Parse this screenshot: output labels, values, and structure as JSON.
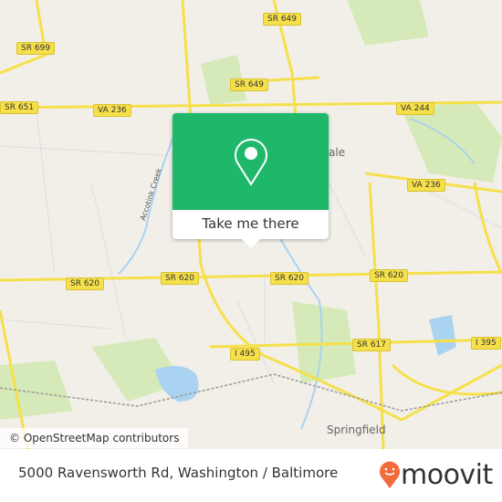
{
  "map": {
    "shields": [
      {
        "id": "sr699",
        "label": "SR 699"
      },
      {
        "id": "sr651",
        "label": "SR 651"
      },
      {
        "id": "va236w",
        "label": "VA 236"
      },
      {
        "id": "sr649n",
        "label": "SR 649"
      },
      {
        "id": "sr649s",
        "label": "SR 649"
      },
      {
        "id": "va244",
        "label": "VA 244"
      },
      {
        "id": "va236e",
        "label": "VA 236"
      },
      {
        "id": "sr620a",
        "label": "SR 620"
      },
      {
        "id": "sr620b",
        "label": "SR 620"
      },
      {
        "id": "sr620c",
        "label": "SR 620"
      },
      {
        "id": "sr620d",
        "label": "SR 620"
      },
      {
        "id": "sr617",
        "label": "SR 617"
      },
      {
        "id": "i495",
        "label": "I 495"
      },
      {
        "id": "i395",
        "label": "I 395"
      }
    ],
    "places": {
      "annandale_partial": "ale",
      "springfield": "Springfield",
      "creek": "Accotink Creek"
    },
    "attribution": "© OpenStreetMap contributors",
    "colors": {
      "land": "#f2efe9",
      "road": "#f6e04a",
      "water": "#a9d3f0",
      "park": "#d5eab8",
      "popup": "#1fb86b"
    }
  },
  "popup": {
    "icon": "map-pin-icon",
    "button_label": "Take me there"
  },
  "footer": {
    "address": "5000 Ravensworth Rd, Washington / Baltimore",
    "brand": "moovit",
    "brand_color": "#f26b3a"
  }
}
